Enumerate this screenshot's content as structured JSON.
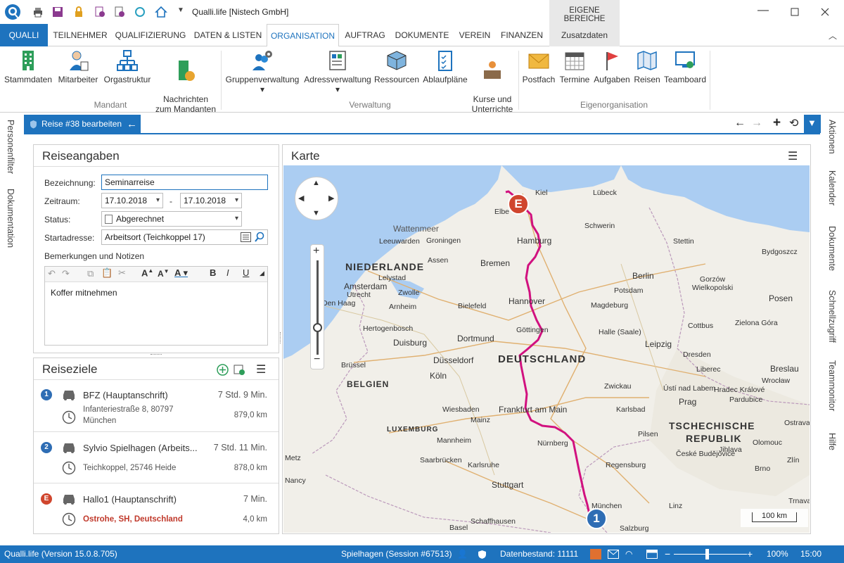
{
  "app": {
    "title": "Qualli.life [Nistech GmbH]",
    "context_group": "EIGENE BEREICHE"
  },
  "tabs": [
    {
      "label": "QUALLI"
    },
    {
      "label": "TEILNEHMER"
    },
    {
      "label": "QUALIFIZIERUNG"
    },
    {
      "label": "DATEN & LISTEN"
    },
    {
      "label": "ORGANISATION"
    },
    {
      "label": "AUFTRAG"
    },
    {
      "label": "DOKUMENTE"
    },
    {
      "label": "VEREIN"
    },
    {
      "label": "FINANZEN"
    },
    {
      "label": "Zusatzdaten"
    }
  ],
  "ribbon": {
    "groups": [
      {
        "label": "Mandant"
      },
      {
        "label": "Verwaltung"
      },
      {
        "label": "Eigenorganisation"
      }
    ],
    "buttons": [
      {
        "label": "Stammdaten"
      },
      {
        "label": "Mitarbeiter"
      },
      {
        "label": "Orgastruktur"
      },
      {
        "label": "Nachrichten\nzum Mandanten"
      },
      {
        "label": "Gruppenverwaltung"
      },
      {
        "label": "Adressverwaltung"
      },
      {
        "label": "Ressourcen"
      },
      {
        "label": "Ablaufpläne"
      },
      {
        "label": "Kurse und\nUnterrichte"
      },
      {
        "label": "Postfach"
      },
      {
        "label": "Termine"
      },
      {
        "label": "Aufgaben"
      },
      {
        "label": "Reisen"
      },
      {
        "label": "Teamboard"
      }
    ]
  },
  "left_sidebar": [
    "Personenfilter",
    "Dokumentation"
  ],
  "right_sidebar": [
    "Aktionen",
    "Kalender",
    "Dokumente",
    "Schnellzugriff",
    "Teammonitor",
    "Hilfe"
  ],
  "doc_tab": {
    "label": "Reise #38 bearbeiten"
  },
  "reiseangaben": {
    "title": "Reiseangaben",
    "bezeichnung_label": "Bezeichnung:",
    "bezeichnung_value": "Seminarreise",
    "zeitraum_label": "Zeitraum:",
    "date_from": "17.10.2018",
    "date_sep": "-",
    "date_to": "17.10.2018",
    "status_label": "Status:",
    "status_value": "Abgerechnet",
    "start_label": "Startadresse:",
    "start_value": "Arbeitsort (Teichkoppel 17)",
    "notes_label": "Bemerkungen und Notizen",
    "notes_value": "Koffer mitnehmen"
  },
  "reiseziele": {
    "title": "Reiseziele",
    "items": [
      {
        "badge": "1",
        "badge_color": "#2e6db4",
        "name": "BFZ (Hauptanschrift)",
        "duration": "7 Std. 9 Min.",
        "address1": "Infanteriestraße 8, 80797",
        "address2": "München",
        "distance": "879,0 km"
      },
      {
        "badge": "2",
        "badge_color": "#2e6db4",
        "name": "Sylvio Spielhagen (Arbeits...",
        "duration": "7 Std. 11 Min.",
        "address1": "Teichkoppel, 25746 Heide",
        "distance": "878,0 km"
      },
      {
        "badge": "E",
        "badge_color": "#d0462e",
        "name": "Hallo1 (Hauptanschrift)",
        "duration": "7 Min.",
        "address1": "Ostrohe, SH, Deutschland",
        "distance": "4,0 km"
      }
    ]
  },
  "karte": {
    "title": "Karte",
    "scale": "100 km",
    "countries": [
      "NIEDERLANDE",
      "DEUTSCHLAND",
      "BELGIEN",
      "LUXEMBURG",
      "TSCHECHISCHE",
      "REPUBLIK"
    ],
    "sea": "Wattenmeer",
    "cities": [
      "Kiel",
      "Lübeck",
      "Elbe",
      "Schwerin",
      "Hamburg",
      "Stettin",
      "Bydgoszcz",
      "Bremen",
      "Groningen",
      "Leeuwarden",
      "Assen",
      "Lelystad",
      "Amsterdam",
      "Zwolle",
      "Den Haag",
      "Arnheim",
      "Hertogenbosch",
      "Utrecht",
      "Berlin",
      "Potsdam",
      "Gorzów Wielkopolski",
      "Hannover",
      "Magdeburg",
      "Posen",
      "Bielefeld",
      "Halle (Saale)",
      "Göttingen",
      "Dortmund",
      "Duisburg",
      "Düsseldorf",
      "Köln",
      "Brüssel",
      "Leipzig",
      "Cottbus",
      "Zielona Góra",
      "Dresden",
      "Breslau",
      "Wrocław",
      "Liberec",
      "Zwickau",
      "Ústí nad Labem",
      "Hradec Králové",
      "Pardubice",
      "Frankfurt am Main",
      "Wiesbaden",
      "Mainz",
      "Prag",
      "Karlsbad",
      "Pilsen",
      "Nürnberg",
      "Mannheim",
      "Saarbrücken",
      "Karlsruhe",
      "Regensburg",
      "České Budějovice",
      "Jihlava",
      "Olomouc",
      "Brno",
      "Zlín",
      "Stuttgart",
      "München",
      "Linz",
      "Basel",
      "Schaffhausen",
      "Salzburg",
      "Ostrava",
      "Nancy",
      "Metz",
      "Trnava"
    ],
    "marker_start": "E",
    "marker_end": "1"
  },
  "statusbar": {
    "version": "Qualli.life (Version 15.0.8.705)",
    "session": "Spielhagen (Session #67513)",
    "datenbestand": "Datenbestand: 11111",
    "zoom": "100%",
    "time": "15:00"
  },
  "colors": {
    "accent": "#1e73be",
    "route": "#d1117f",
    "marker_blue": "#2e6db4",
    "marker_red": "#d0462e",
    "map_land": "#f1efe9",
    "map_water": "#abcdf2"
  }
}
